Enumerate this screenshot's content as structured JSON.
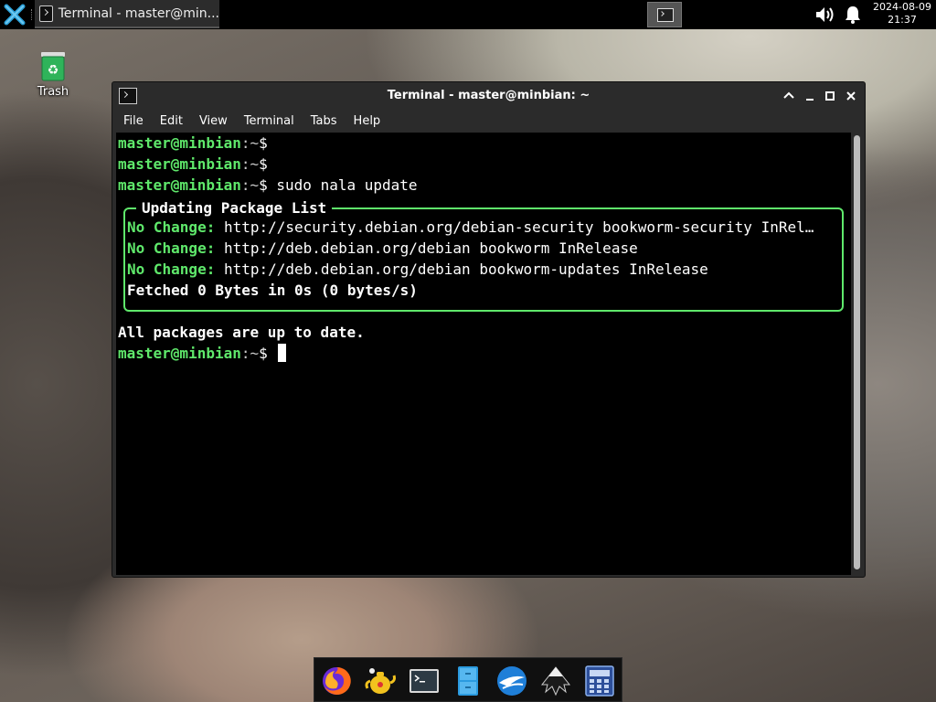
{
  "panel": {
    "app_menu_icon": "xfce-logo-icon",
    "task_title": "Terminal - master@min...",
    "clock_date": "2024-08-09",
    "clock_time": "21:37"
  },
  "desktop": {
    "trash_label": "Trash"
  },
  "window": {
    "title": "Terminal - master@minbian: ~",
    "menu": [
      "File",
      "Edit",
      "View",
      "Terminal",
      "Tabs",
      "Help"
    ]
  },
  "terminal": {
    "prompt_user": "master@minbian",
    "prompt_path": ":~",
    "prompt_symbol": "$",
    "command": "sudo nala update",
    "box_title": "Updating Package List",
    "rows": [
      {
        "label": "No Change:",
        "text": "http://security.debian.org/debian-security bookworm-security InRel…"
      },
      {
        "label": "No Change:",
        "text": "http://deb.debian.org/debian bookworm InRelease"
      },
      {
        "label": "No Change:",
        "text": "http://deb.debian.org/debian bookworm-updates InRelease"
      }
    ],
    "fetched": "Fetched 0 Bytes in 0s (0 bytes/s)",
    "status": "All packages are up to date."
  },
  "dock": {
    "items": [
      "firefox-icon",
      "teapot-icon",
      "terminal-icon",
      "file-manager-icon",
      "browser-globe-icon",
      "inkscape-icon",
      "calculator-icon"
    ]
  }
}
